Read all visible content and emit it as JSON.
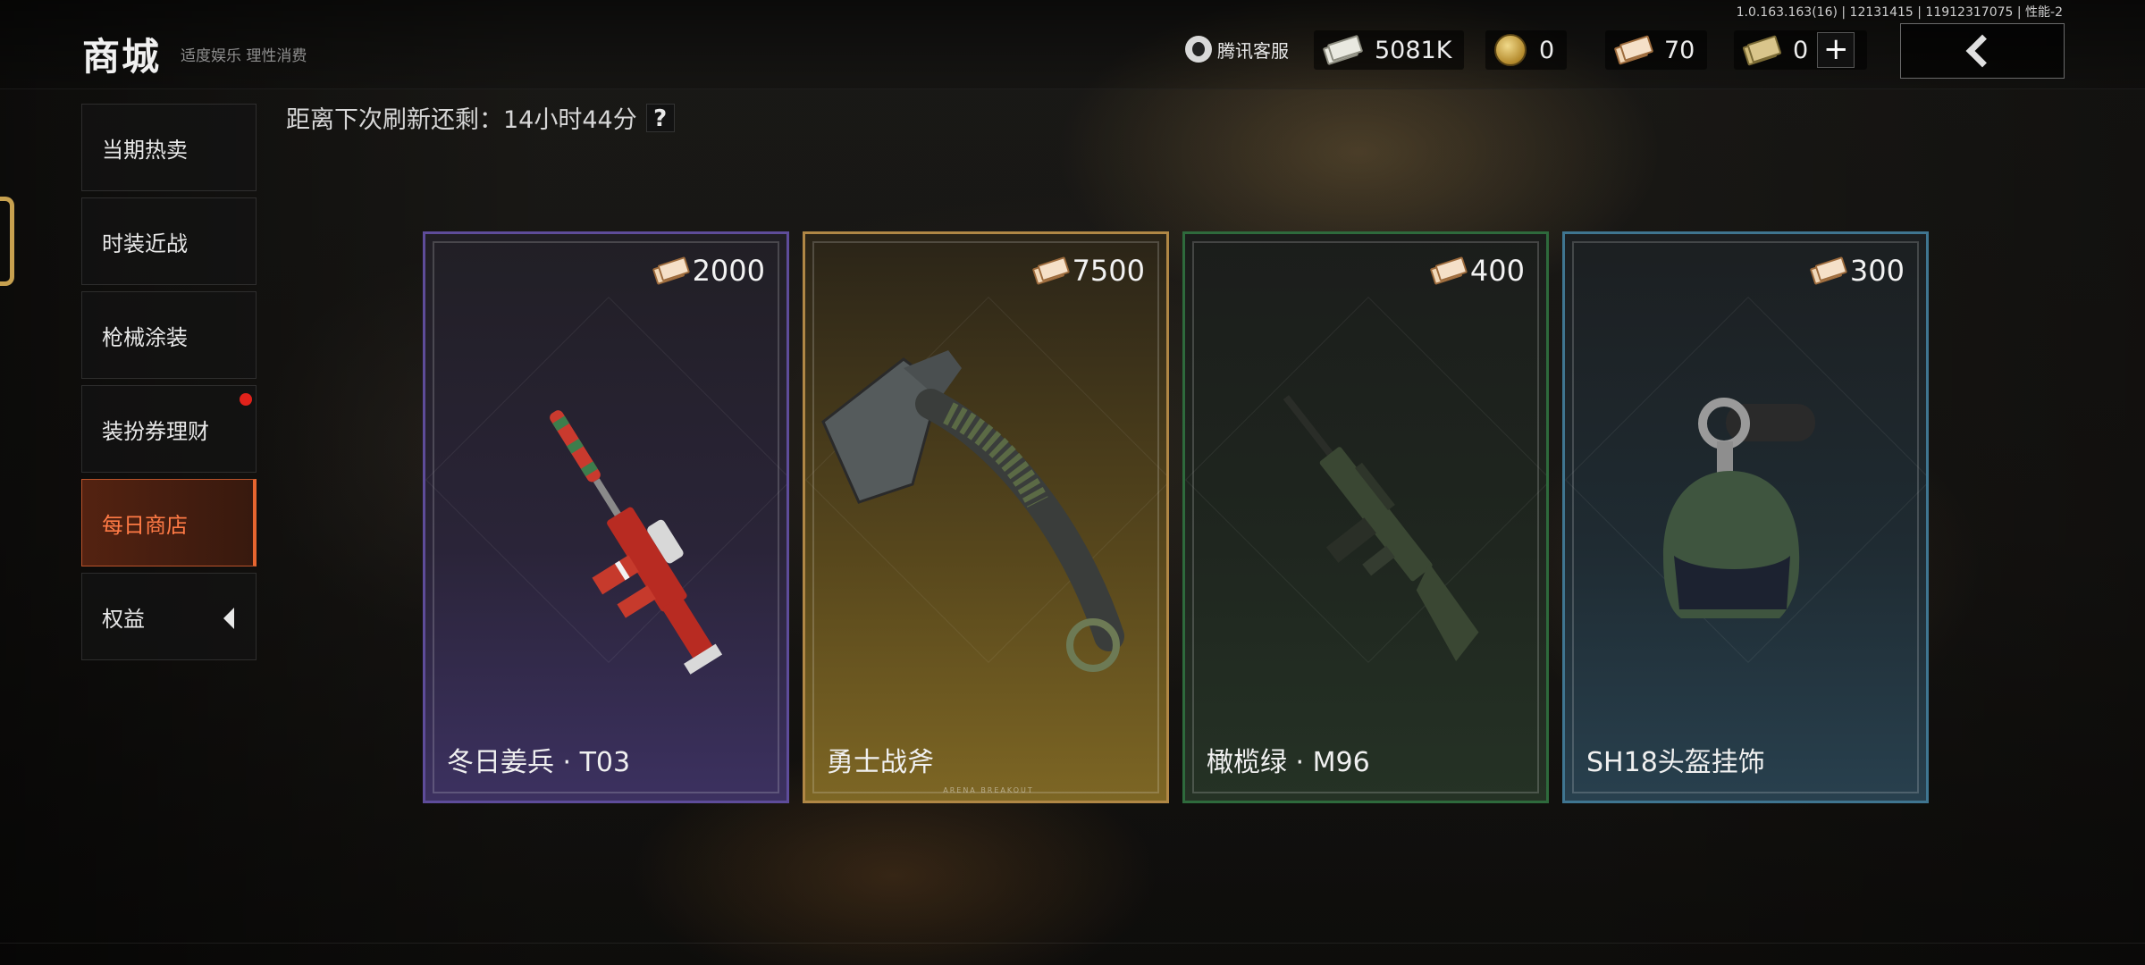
{
  "header": {
    "title": "商城",
    "subtitle": "适度娱乐 理性消费",
    "version": "1.0.163.163(16) | 12131415 | 11912317075 | 性能-2",
    "support_label": "腾讯客服"
  },
  "currencies": [
    {
      "icon": "cash-icon",
      "value": "5081K"
    },
    {
      "icon": "coin-icon",
      "value": "0"
    },
    {
      "icon": "ticket-icon",
      "value": "70"
    },
    {
      "icon": "voucher-icon",
      "value": "0"
    }
  ],
  "sidebar": {
    "items": [
      {
        "label": "当期热卖",
        "active": false
      },
      {
        "label": "时装近战",
        "active": false
      },
      {
        "label": "枪械涂装",
        "active": false
      },
      {
        "label": "装扮券理财",
        "active": false,
        "badge": true
      },
      {
        "label": "每日商店",
        "active": true
      },
      {
        "label": "权益",
        "active": false,
        "expand": true
      }
    ]
  },
  "refresh": {
    "text": "距离下次刷新还剩：14小时44分",
    "help": "?"
  },
  "cards": [
    {
      "name": "冬日姜兵 · T03",
      "price": "2000",
      "rarity_color": "#5e4c9a",
      "item_icon": "rifle-icon"
    },
    {
      "name": "勇士战斧",
      "price": "7500",
      "rarity_color": "#b08745",
      "item_icon": "axe-icon"
    },
    {
      "name": "橄榄绿 · M96",
      "price": "400",
      "rarity_color": "#2e6a3c",
      "item_icon": "rifle-icon"
    },
    {
      "name": "SH18头盔挂饰",
      "price": "300",
      "rarity_color": "#3f7590",
      "item_icon": "helmet-charm-icon"
    }
  ],
  "card_brand": "ARENA BREAKOUT"
}
